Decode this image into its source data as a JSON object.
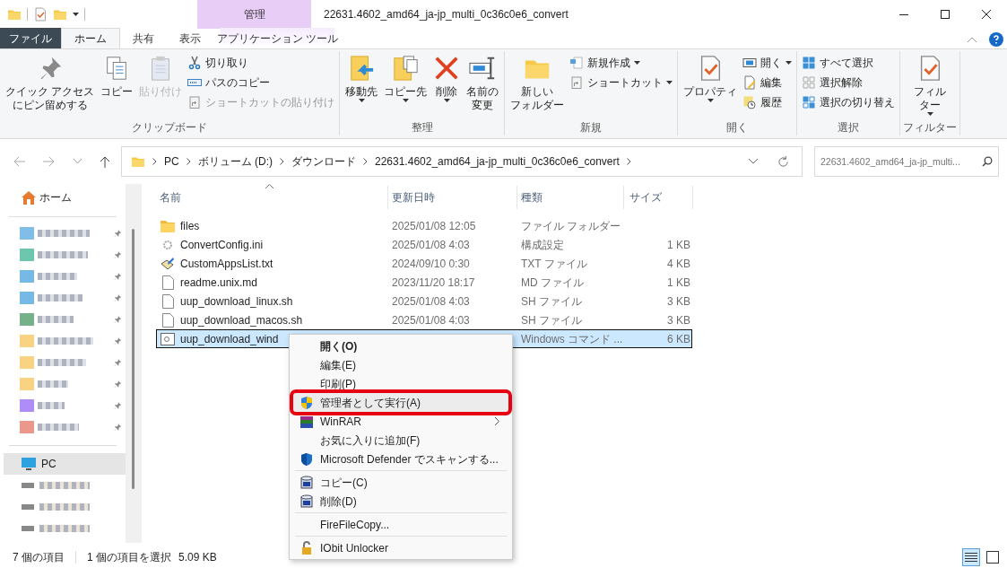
{
  "window": {
    "title": "22631.4602_amd64_ja-jp_multi_0c36c0e6_convert",
    "context_tab_group": "管理"
  },
  "ribbon_tabs": [
    {
      "label": "ファイル",
      "kind": "file",
      "selected": false
    },
    {
      "label": "ホーム",
      "kind": "tab",
      "selected": true
    },
    {
      "label": "共有",
      "kind": "tab",
      "selected": false
    },
    {
      "label": "表示",
      "kind": "tab",
      "selected": false
    },
    {
      "label": "アプリケーション ツール",
      "kind": "context",
      "selected": false
    }
  ],
  "ribbon_groups": [
    {
      "label": "クリップボード",
      "items": [
        {
          "kind": "large",
          "lines": [
            "クイック アクセス",
            "にピン留めする"
          ],
          "disabled": false,
          "dropdown": false
        },
        {
          "kind": "large",
          "lines": [
            "コピー"
          ],
          "disabled": false,
          "dropdown": false
        },
        {
          "kind": "large",
          "lines": [
            "貼り付け"
          ],
          "disabled": true,
          "dropdown": false
        },
        {
          "kind": "small",
          "lines": [
            "切り取り"
          ],
          "disabled": false,
          "dropdown": false
        },
        {
          "kind": "small",
          "lines": [
            "パスのコピー"
          ],
          "disabled": false,
          "dropdown": false
        },
        {
          "kind": "small",
          "lines": [
            "ショートカットの貼り付け"
          ],
          "disabled": true,
          "dropdown": false
        }
      ]
    },
    {
      "label": "整理",
      "items": [
        {
          "kind": "large",
          "lines": [
            "移動先"
          ],
          "disabled": false,
          "dropdown": true
        },
        {
          "kind": "large",
          "lines": [
            "コピー先"
          ],
          "disabled": false,
          "dropdown": true
        },
        {
          "kind": "large",
          "lines": [
            "削除"
          ],
          "disabled": false,
          "dropdown": true
        },
        {
          "kind": "large",
          "lines": [
            "名前の",
            "変更"
          ],
          "disabled": false,
          "dropdown": false
        }
      ]
    },
    {
      "label": "新規",
      "items": [
        {
          "kind": "large",
          "lines": [
            "新しい",
            "フォルダー"
          ],
          "disabled": false,
          "dropdown": false
        },
        {
          "kind": "small",
          "lines": [
            "新規作成"
          ],
          "disabled": false,
          "dropdown": true
        },
        {
          "kind": "small",
          "lines": [
            "ショートカット"
          ],
          "disabled": false,
          "dropdown": true
        }
      ]
    },
    {
      "label": "開く",
      "items": [
        {
          "kind": "large",
          "lines": [
            "プロパティ"
          ],
          "disabled": false,
          "dropdown": true
        },
        {
          "kind": "small",
          "lines": [
            "開く"
          ],
          "disabled": false,
          "dropdown": true
        },
        {
          "kind": "small",
          "lines": [
            "編集"
          ],
          "disabled": false,
          "dropdown": false
        },
        {
          "kind": "small",
          "lines": [
            "履歴"
          ],
          "disabled": false,
          "dropdown": false
        }
      ]
    },
    {
      "label": "選択",
      "items": [
        {
          "kind": "small",
          "lines": [
            "すべて選択"
          ],
          "disabled": false,
          "dropdown": false
        },
        {
          "kind": "small",
          "lines": [
            "選択解除"
          ],
          "disabled": false,
          "dropdown": false
        },
        {
          "kind": "small",
          "lines": [
            "選択の切り替え"
          ],
          "disabled": false,
          "dropdown": false
        }
      ]
    },
    {
      "label": "フィルター",
      "items": [
        {
          "kind": "large",
          "lines": [
            "フィル",
            "ター"
          ],
          "disabled": false,
          "dropdown": true
        }
      ]
    }
  ],
  "address_bar": {
    "crumbs": [
      "PC",
      "ボリューム (D:)",
      "ダウンロード",
      "22631.4602_amd64_ja-jp_multi_0c36c0e6_convert"
    ]
  },
  "search": {
    "placeholder": "22631.4602_amd64_ja-jp_multi..."
  },
  "sidebar": {
    "home": "ホーム",
    "pinned": [
      {
        "pinned": true
      },
      {
        "pinned": true
      },
      {
        "pinned": true
      },
      {
        "pinned": true
      },
      {
        "pinned": true
      },
      {
        "pinned": true
      },
      {
        "pinned": true
      },
      {
        "pinned": true
      },
      {
        "pinned": true
      },
      {
        "pinned": true
      }
    ],
    "pc": {
      "label": "PC",
      "selected": true
    },
    "drives": [
      {
        "pinned": false
      },
      {
        "pinned": false
      },
      {
        "pinned": false
      }
    ]
  },
  "table": {
    "columns": [
      "名前",
      "更新日時",
      "種類",
      "サイズ"
    ],
    "rows": [
      {
        "kind": "folder",
        "name": "files",
        "date": "2025/01/08 12:05",
        "type": "ファイル フォルダー",
        "size": "",
        "selected": false
      },
      {
        "kind": "ini",
        "name": "ConvertConfig.ini",
        "date": "2025/01/08 4:03",
        "type": "構成設定",
        "size": "1 KB",
        "selected": false
      },
      {
        "kind": "txt",
        "name": "CustomAppsList.txt",
        "date": "2024/09/10 0:30",
        "type": "TXT ファイル",
        "size": "4 KB",
        "selected": false
      },
      {
        "kind": "file",
        "name": "readme.unix.md",
        "date": "2023/11/20 18:17",
        "type": "MD ファイル",
        "size": "1 KB",
        "selected": false
      },
      {
        "kind": "file",
        "name": "uup_download_linux.sh",
        "date": "2025/01/08 4:03",
        "type": "SH ファイル",
        "size": "3 KB",
        "selected": false
      },
      {
        "kind": "file",
        "name": "uup_download_macos.sh",
        "date": "2025/01/08 4:03",
        "type": "SH ファイル",
        "size": "3 KB",
        "selected": false
      },
      {
        "kind": "cmd",
        "name": "uup_download_wind",
        "date": "",
        "type": "Windows コマンド ...",
        "size": "6 KB",
        "selected": true
      }
    ]
  },
  "context_menu": [
    {
      "kind": "item",
      "label": "開く(O)",
      "bold": true,
      "highlighted": false,
      "submenu": false
    },
    {
      "kind": "item",
      "label": "編集(E)",
      "bold": false,
      "highlighted": false,
      "submenu": false
    },
    {
      "kind": "item",
      "label": "印刷(P)",
      "bold": false,
      "highlighted": false,
      "submenu": false
    },
    {
      "kind": "item",
      "label": "管理者として実行(A)",
      "bold": false,
      "highlighted": true,
      "submenu": false
    },
    {
      "kind": "item",
      "label": "WinRAR",
      "bold": false,
      "highlighted": false,
      "submenu": true
    },
    {
      "kind": "item",
      "label": "お気に入りに追加(F)",
      "bold": false,
      "highlighted": false,
      "submenu": false
    },
    {
      "kind": "item",
      "label": "Microsoft Defender でスキャンする...",
      "bold": false,
      "highlighted": false,
      "submenu": false
    },
    {
      "kind": "separator"
    },
    {
      "kind": "item",
      "label": "コピー(C)",
      "bold": false,
      "highlighted": false,
      "submenu": false
    },
    {
      "kind": "item",
      "label": "削除(D)",
      "bold": false,
      "highlighted": false,
      "submenu": false
    },
    {
      "kind": "separator"
    },
    {
      "kind": "item",
      "label": "FireFileCopy...",
      "bold": false,
      "highlighted": false,
      "submenu": false
    },
    {
      "kind": "separator"
    },
    {
      "kind": "item",
      "label": "IObit Unlocker",
      "bold": false,
      "highlighted": false,
      "submenu": false
    }
  ],
  "status_bar": {
    "count": "7 個の項目",
    "selection": "1 個の項目を選択",
    "size": "5.09 KB",
    "views": [
      {
        "kind": "details",
        "selected": true
      },
      {
        "kind": "icons",
        "selected": false
      }
    ]
  }
}
